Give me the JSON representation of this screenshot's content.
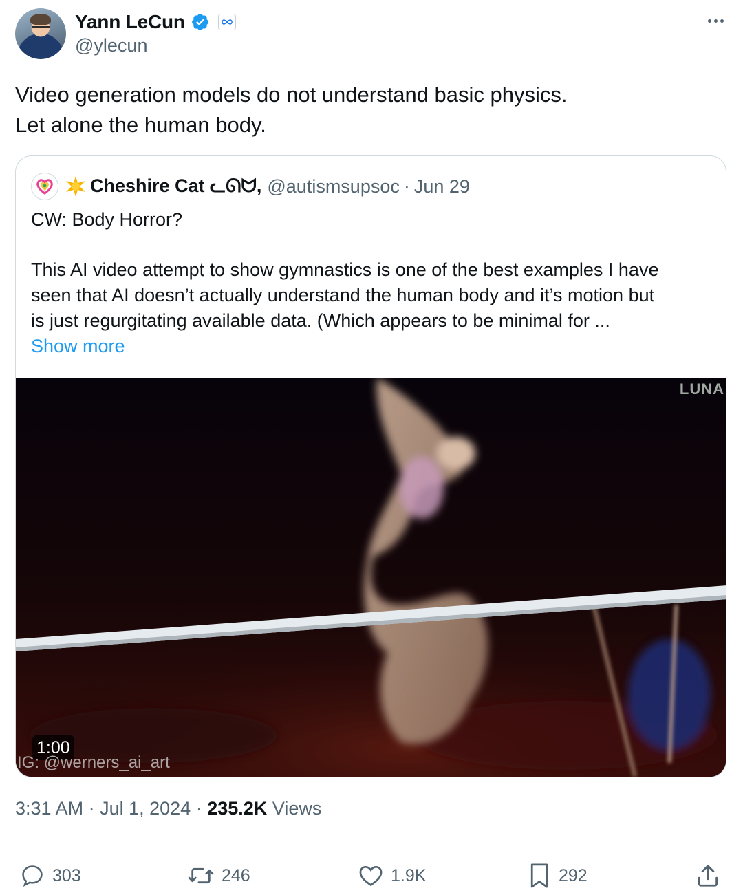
{
  "author": {
    "display_name": "Yann LeCun",
    "handle": "@ylecun",
    "verified": true,
    "affiliation_icon": "meta-infinity-icon"
  },
  "tweet": {
    "text_lines": [
      "Video generation models do not understand basic physics.",
      "Let alone the human body."
    ]
  },
  "quote": {
    "display_name": "Cheshire Cat ᓚᘏᗢ,",
    "handle": "@autismsupsoc",
    "separator": "·",
    "date": "Jun 29",
    "text_first": "CW: Body Horror?",
    "text_lines": [
      "This AI video attempt to show gymnastics is one of the best examples I have",
      "seen that AI doesn’t actually understand the human body and it’s motion but",
      "is just regurgitating available data. (Which appears to be minimal for ..."
    ],
    "show_more": "Show more",
    "media": {
      "duration": "1:00",
      "watermark": "IG: @werners_ai_art",
      "corner_logo": "LUNA"
    }
  },
  "meta": {
    "time": "3:31 AM",
    "dot1": "·",
    "date": "Jul 1, 2024",
    "dot2": "·",
    "views_count": "235.2K",
    "views_label": "Views"
  },
  "actions": {
    "replies": "303",
    "reposts": "246",
    "likes": "1.9K",
    "bookmarks": "292"
  },
  "colors": {
    "text_primary": "#0f1419",
    "text_secondary": "#536471",
    "link": "#1d9bf0",
    "border": "#cfd9de",
    "verified": "#1d9bf0"
  }
}
